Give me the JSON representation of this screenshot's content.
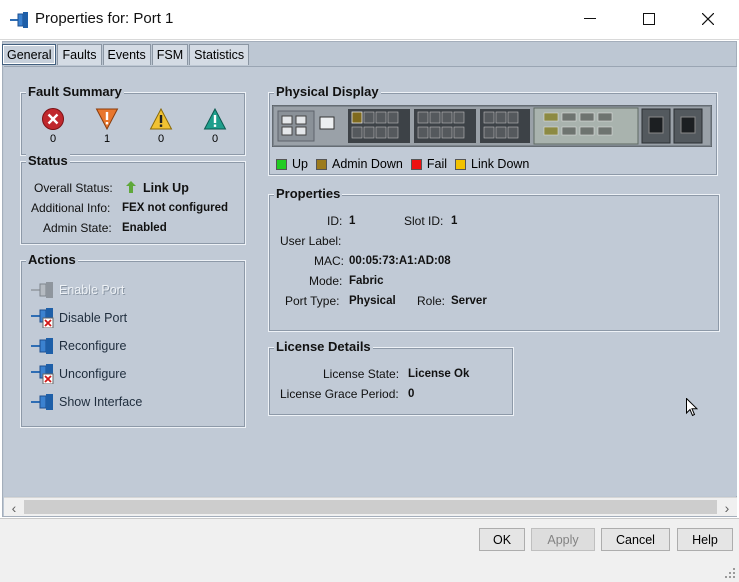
{
  "window": {
    "title": "Properties for: Port 1"
  },
  "tabs": [
    {
      "label": "General",
      "active": true
    },
    {
      "label": "Faults"
    },
    {
      "label": "Events"
    },
    {
      "label": "FSM"
    },
    {
      "label": "Statistics"
    }
  ],
  "fault_summary": {
    "title": "Fault Summary",
    "critical": {
      "icon": "critical-x-icon",
      "count": "0",
      "color": "#c0282d"
    },
    "major": {
      "icon": "major-down-triangle-icon",
      "count": "1",
      "color": "#e8772e"
    },
    "minor": {
      "icon": "minor-warning-triangle-icon",
      "count": "0",
      "color": "#f1c232"
    },
    "warning": {
      "icon": "warning-triangle-icon",
      "count": "0",
      "color": "#1f9e8c"
    }
  },
  "status": {
    "title": "Status",
    "overall_label": "Overall Status:",
    "overall_value": "Link Up",
    "additional_label": "Additional Info:",
    "additional_value": "FEX not configured",
    "admin_label": "Admin State:",
    "admin_value": "Enabled"
  },
  "actions": {
    "title": "Actions",
    "items": [
      {
        "label": "Enable Port",
        "enabled": false,
        "icon": "port-plug-icon"
      },
      {
        "label": "Disable Port",
        "enabled": true,
        "icon": "port-disable-icon"
      },
      {
        "label": "Reconfigure",
        "enabled": true,
        "icon": "port-plug-icon"
      },
      {
        "label": "Unconfigure",
        "enabled": true,
        "icon": "port-disable-icon"
      },
      {
        "label": "Show Interface",
        "enabled": true,
        "icon": "port-plug-icon"
      }
    ]
  },
  "physical_display": {
    "title": "Physical Display",
    "legend": [
      {
        "label": "Up",
        "color": "#22cc22"
      },
      {
        "label": "Admin Down",
        "color": "#9c7b1c"
      },
      {
        "label": "Fail",
        "color": "#ee1111"
      },
      {
        "label": "Link Down",
        "color": "#f2c200"
      }
    ]
  },
  "properties": {
    "title": "Properties",
    "id_label": "ID:",
    "id_value": "1",
    "slot_label": "Slot ID:",
    "slot_value": "1",
    "user_label_label": "User Label:",
    "user_label_value": "",
    "mac_label": "MAC:",
    "mac_value": "00:05:73:A1:AD:08",
    "mode_label": "Mode:",
    "mode_value": "Fabric",
    "port_type_label": "Port Type:",
    "port_type_value": "Physical",
    "role_label": "Role:",
    "role_value": "Server"
  },
  "license": {
    "title": "License Details",
    "state_label": "License State:",
    "state_value": "License Ok",
    "grace_label": "License Grace Period:",
    "grace_value": "0"
  },
  "buttons": {
    "ok": "OK",
    "apply": "Apply",
    "cancel": "Cancel",
    "help": "Help"
  }
}
